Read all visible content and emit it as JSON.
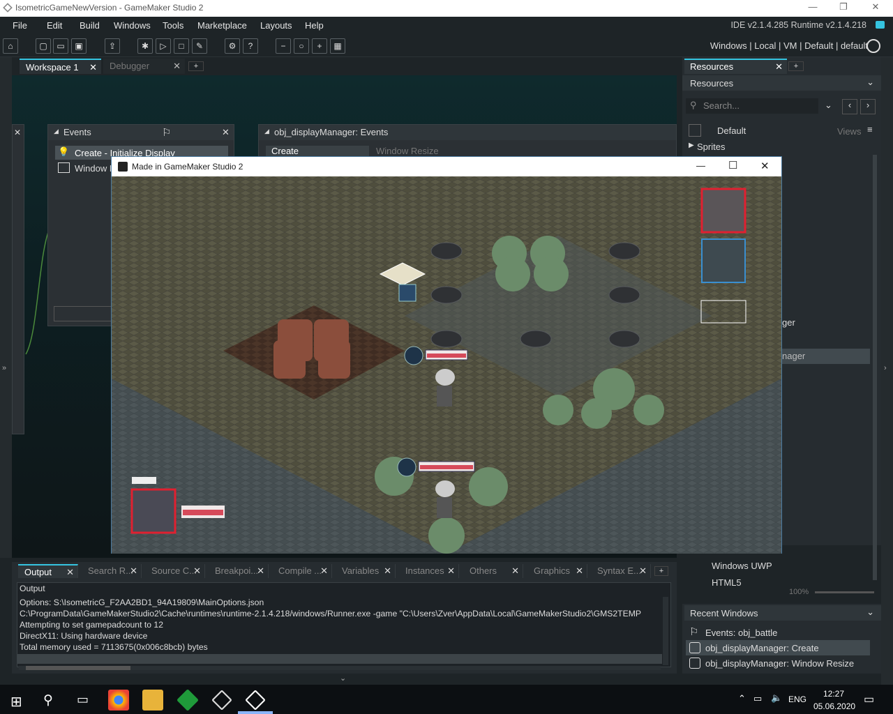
{
  "window": {
    "title": "IsometricGameNewVersion - GameMaker Studio 2",
    "minimize": "—",
    "restore": "❐",
    "close": "✕"
  },
  "menu": {
    "items": [
      "File",
      "Edit",
      "Build",
      "Windows",
      "Tools",
      "Marketplace",
      "Layouts",
      "Help"
    ],
    "ide_version": "IDE v2.1.4.285 Runtime v2.1.4.218"
  },
  "target": {
    "platform": "Windows",
    "sep1": "|",
    "device": "Local",
    "sep2": "|",
    "output": "VM",
    "sep3": "|",
    "config": "Default",
    "sep4": "|",
    "option": "default"
  },
  "tabs": {
    "workspace": "Workspace 1",
    "debugger": "Debugger",
    "add": "+"
  },
  "events_panel": {
    "title": "Events",
    "items": [
      "Create - Initialize Display",
      "Window R"
    ]
  },
  "obj_events": {
    "title": "obj_displayManager: Events",
    "tab_create": "Create",
    "tab_resize": "Window Resize"
  },
  "game_window": {
    "title": "Made in GameMaker Studio 2",
    "minimize": "—",
    "maximize": "☐",
    "close": "✕"
  },
  "resources": {
    "tab": "Resources",
    "add": "+",
    "header": "Resources",
    "search_placeholder": "Search...",
    "group": "Default",
    "views": "Views",
    "tree_first": "Sprites",
    "partial_a": "ger",
    "partial_b": "nager",
    "uwp": "Windows UWP",
    "html5": "HTML5",
    "zoom": "100%"
  },
  "recent": {
    "title": "Recent Windows",
    "items": [
      "Events: obj_battle",
      "obj_displayManager: Create",
      "obj_displayManager: Window Resize"
    ]
  },
  "output_tabs": [
    "Output",
    "Search R...",
    "Source C...",
    "Breakpoi...",
    "Compile ...",
    "Variables",
    "Instances",
    "Others",
    "Graphics",
    "Syntax E..."
  ],
  "output": {
    "header": "Output",
    "lines": [
      "Options: S:\\IsometricG_F2AA2BD1_94A19809\\MainOptions.json",
      "C:\\ProgramData\\GameMakerStudio2\\Cache\\runtimes\\runtime-2.1.4.218/windows/Runner.exe  -game \"C:\\Users\\Zver\\AppData\\Local\\GameMakerStudio2\\GMS2TEMP",
      "Attempting to set gamepadcount to 12",
      "DirectX11: Using hardware device",
      "Total memory used = 7113675(0x006c8bcb) bytes"
    ]
  },
  "taskbar": {
    "lang": "ENG",
    "time": "12:27",
    "date": "05.06.2020"
  },
  "colors": {
    "accent": "#35c4e0",
    "bg": "#1e2427",
    "hp_red": "#d64a5a",
    "selection_red": "#e02030"
  }
}
